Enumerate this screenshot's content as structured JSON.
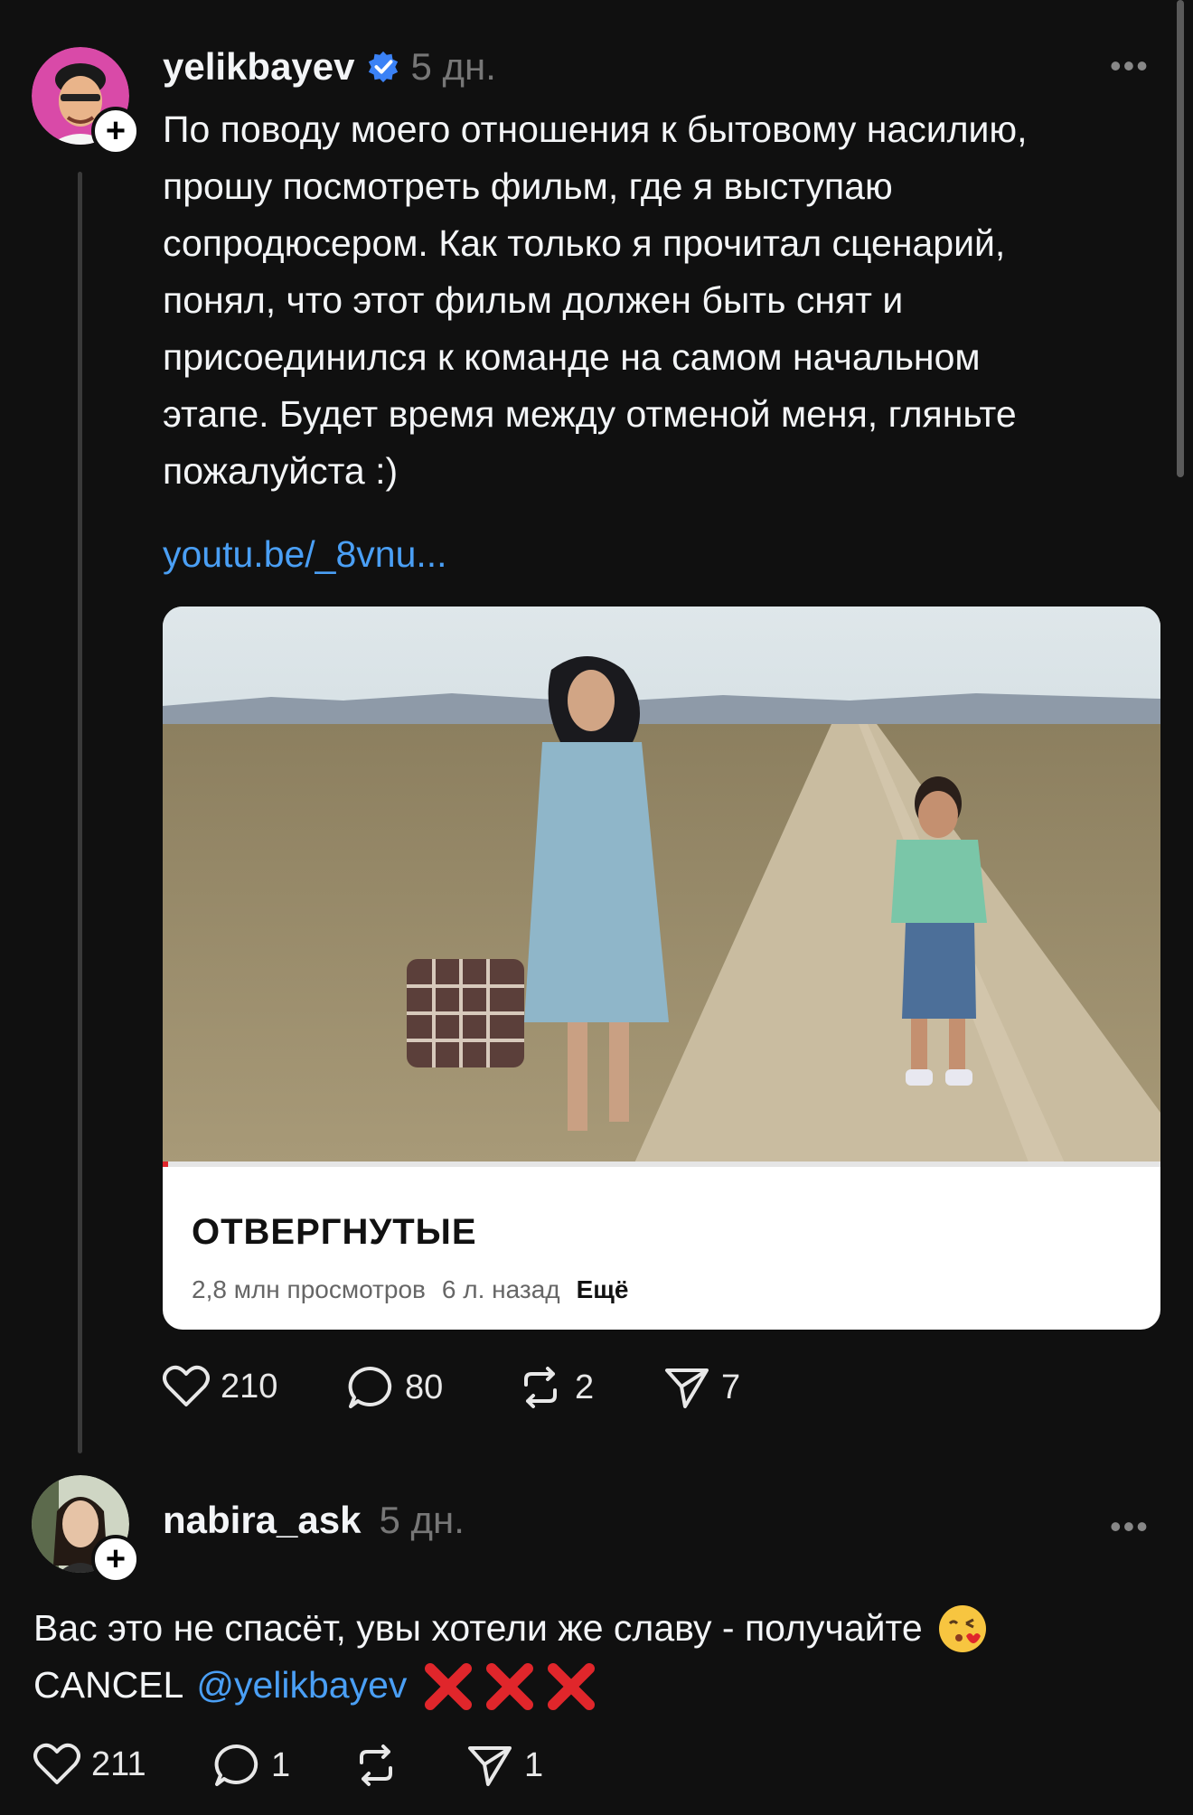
{
  "post1": {
    "username": "yelikbayev",
    "time": "5 дн.",
    "more": "•••",
    "lines": [
      "По поводу моего отношения к бытовому насилию,",
      "прошу посмотреть фильм, где я выступаю",
      "сопродюсером. Как только я прочитал сценарий,",
      "понял, что этот фильм должен быть снят и",
      "присоединился к команде на самом начальном",
      "этапе. Будет время между отменой меня, гляньте",
      "пожалуйста :)"
    ],
    "link": "youtu.be/_8vnu...",
    "card": {
      "title": "ОТВЕРГНУТЫЕ",
      "views": "2,8 млн просмотров",
      "ago": "6 л. назад",
      "more": "Ещё"
    },
    "actions": {
      "likes": "210",
      "comments": "80",
      "reposts": "2",
      "shares": "7"
    }
  },
  "post2": {
    "username": "nabira_ask",
    "time": "5 дн.",
    "more": "•••",
    "line1": "Вас это не спасёт, увы хотели же славу - получайте",
    "line2_prefix": "CANCEL",
    "mention": "@yelikbayev",
    "actions": {
      "likes": "211",
      "comments": "1",
      "shares": "1"
    }
  },
  "colors": {
    "background": "#101010",
    "link": "#4a9ff5",
    "verified": "#3b82f6",
    "cross": "#e0262b"
  }
}
